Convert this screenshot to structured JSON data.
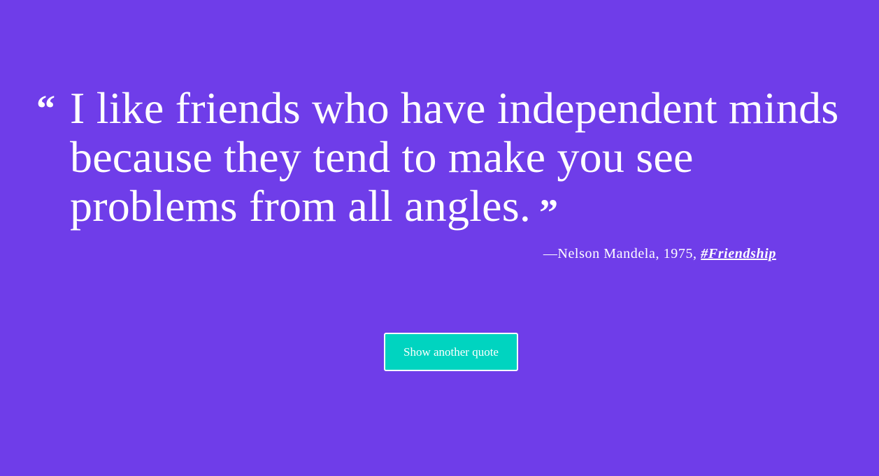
{
  "quote": {
    "open_mark": "“",
    "text": "I like friends who have independent minds because they tend to make you see problems from all angles.",
    "close_mark": "”"
  },
  "attribution": {
    "prefix": "—Nelson Mandela, 1975, ",
    "tag": "#Friendship"
  },
  "actions": {
    "new_quote_label": "Show another quote"
  },
  "colors": {
    "background": "#6f3de9",
    "button": "#00d4c0",
    "text": "#ffffff"
  }
}
